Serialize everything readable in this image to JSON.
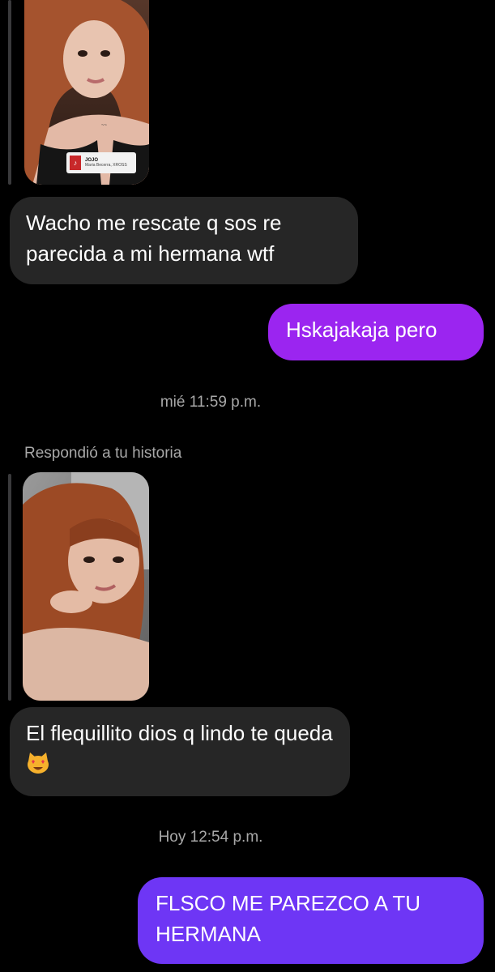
{
  "colors": {
    "background": "#000000",
    "incoming_bubble": "#262626",
    "outgoing_gradient_purple": "#9b25f0",
    "outgoing_gradient_blue": "#6e36f5",
    "meta_text": "#a8a8a8"
  },
  "story_1": {
    "music_sticker": {
      "title": "JOJO",
      "artist": "Maria Becerra, XROSS",
      "icon": "album-cover-icon"
    }
  },
  "messages": [
    {
      "id": "m1",
      "direction": "incoming",
      "text": "Wacho me rescate q sos re parecida a mi hermana wtf"
    },
    {
      "id": "m2",
      "direction": "outgoing",
      "text": "Hskajakaja pero"
    },
    {
      "id": "m3",
      "direction": "incoming",
      "text": "El flequillito dios q lindo te queda",
      "emoji": "smiling-cat-heart-eyes-icon"
    },
    {
      "id": "m4",
      "direction": "outgoing",
      "text": "FLSCO ME PAREZCO A TU HERMANA"
    }
  ],
  "timestamps": {
    "t1": "mié 11:59 p.m.",
    "t2": "Hoy 12:54 p.m."
  },
  "reply_label": "Respondió a tu historia"
}
